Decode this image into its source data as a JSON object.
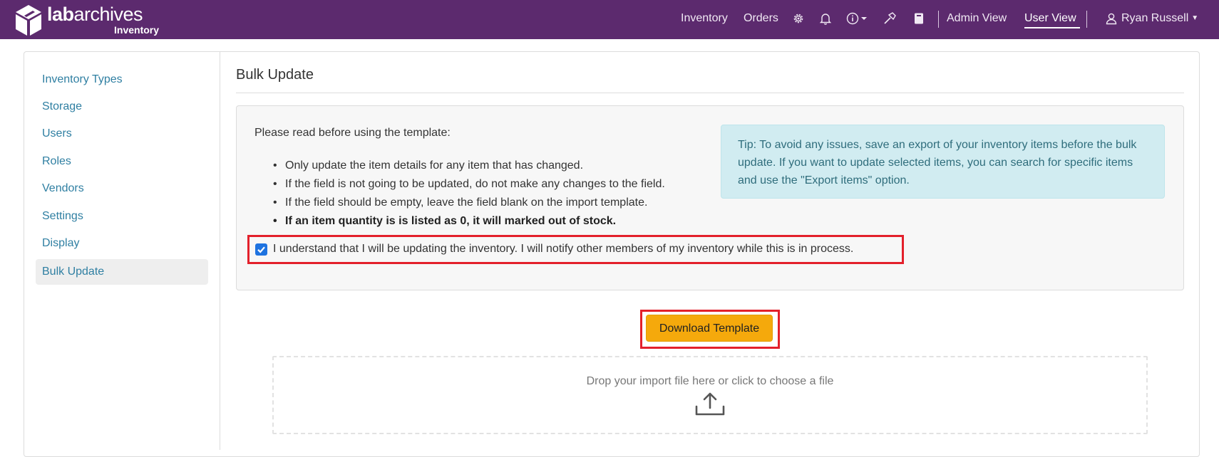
{
  "navbar": {
    "brand_prefix": "lab",
    "brand_suffix": "archives",
    "brand_sub": "Inventory",
    "links": {
      "inventory": "Inventory",
      "orders": "Orders"
    },
    "views": {
      "admin": "Admin View",
      "user": "User View"
    },
    "user_name": "Ryan Russell",
    "icons": [
      "gear-icon",
      "bell-icon",
      "info-icon",
      "hammer-icon",
      "notebook-icon",
      "user-icon"
    ],
    "colors": {
      "bar": "#5c2a6e"
    }
  },
  "sidebar": {
    "items": [
      {
        "label": "Inventory Types",
        "active": false
      },
      {
        "label": "Storage",
        "active": false
      },
      {
        "label": "Users",
        "active": false
      },
      {
        "label": "Roles",
        "active": false
      },
      {
        "label": "Vendors",
        "active": false
      },
      {
        "label": "Settings",
        "active": false
      },
      {
        "label": "Display",
        "active": false
      },
      {
        "label": "Bulk Update",
        "active": true
      }
    ]
  },
  "main": {
    "title": "Bulk Update",
    "instructions_heading": "Please read before using the template:",
    "rules": [
      "Only update the item details for any item that has changed.",
      "If the field is not going to be updated, do not make any changes to the field.",
      "If the field should be empty, leave the field blank on the import template.",
      "If an item quantity is is listed as 0, it will marked out of stock."
    ],
    "tip": "Tip: To avoid any issues, save an export of your inventory items before the bulk update. If you want to update selected items, you can search for specific items and use the \"Export items\" option.",
    "acknowledge_label": "I understand that I will be updating the inventory. I will notify other members of my inventory while this is in process.",
    "acknowledge_checked": true,
    "download_button": "Download Template",
    "dropzone_text": "Drop your import file here or click to choose a file",
    "colors": {
      "accent_button": "#f5a90c",
      "highlight": "#e3202b",
      "link": "#2f7fa2"
    }
  }
}
